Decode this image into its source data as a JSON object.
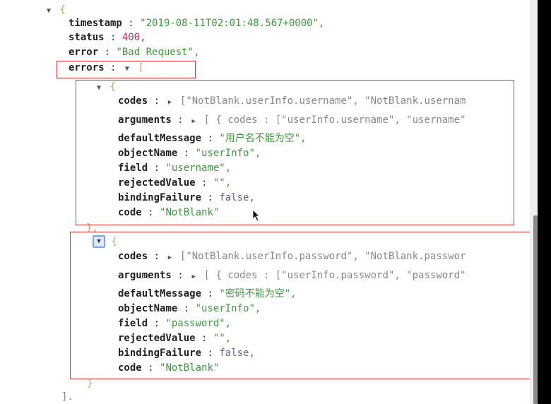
{
  "root": {
    "open_brace": "{",
    "timestamp": {
      "key": "timestamp",
      "value": "\"2019-08-11T02:01:48.567+0000\","
    },
    "status": {
      "key": "status",
      "value": "400,"
    },
    "error": {
      "key": "error",
      "value": "\"Bad Request\","
    },
    "errors": {
      "key": "errors",
      "open": "["
    },
    "close": "].",
    "items": [
      {
        "open": "{",
        "close": "},",
        "codes": {
          "key": "codes",
          "value": "[\"NotBlank.userInfo.username\", \"NotBlank.usernam"
        },
        "arguments": {
          "key": "arguments",
          "value": "[ { codes : [\"userInfo.username\", \"username\""
        },
        "defaultMessage": {
          "key": "defaultMessage",
          "value": "\"用户名不能为空\","
        },
        "objectName": {
          "key": "objectName",
          "value": "\"userInfo\","
        },
        "field": {
          "key": "field",
          "value": "\"username\","
        },
        "rejectedValue": {
          "key": "rejectedValue",
          "value": "\"\","
        },
        "bindingFailure": {
          "key": "bindingFailure",
          "value": "false,"
        },
        "code": {
          "key": "code",
          "value": "\"NotBlank\""
        }
      },
      {
        "open": "{",
        "close": "}",
        "codes": {
          "key": "codes",
          "value": "[\"NotBlank.userInfo.password\", \"NotBlank.passwor"
        },
        "arguments": {
          "key": "arguments",
          "value": "[ { codes : [\"userInfo.password\", \"password\""
        },
        "defaultMessage": {
          "key": "defaultMessage",
          "value": "\"密码不能为空\","
        },
        "objectName": {
          "key": "objectName",
          "value": "\"userInfo\","
        },
        "field": {
          "key": "field",
          "value": "\"password\","
        },
        "rejectedValue": {
          "key": "rejectedValue",
          "value": "\"\","
        },
        "bindingFailure": {
          "key": "bindingFailure",
          "value": "false,"
        },
        "code": {
          "key": "code",
          "value": "\"NotBlank\""
        }
      }
    ]
  },
  "glyphs": {
    "collapse": "▼",
    "expand": "▶",
    "colon": " : "
  },
  "colors": {
    "highlight": "#e03030",
    "string": "#3c9a3c",
    "number": "#b03060",
    "focus": "#7aa7e8"
  }
}
